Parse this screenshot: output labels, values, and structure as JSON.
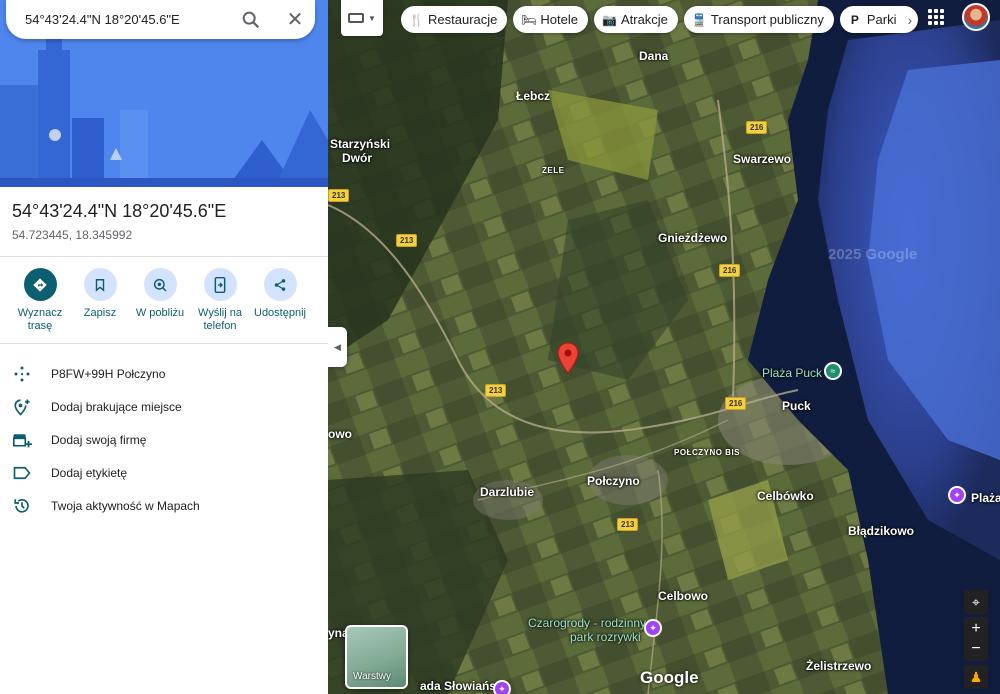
{
  "search": {
    "value": "54°43'24.4\"N 18°20'45.6\"E"
  },
  "place": {
    "title": "54°43'24.4\"N 18°20'45.6\"E",
    "decimal": "54.723445, 18.345992"
  },
  "actions": [
    {
      "label": "Wyznacz trasę",
      "icon": "directions-icon"
    },
    {
      "label": "Zapisz",
      "icon": "bookmark-icon"
    },
    {
      "label": "W pobliżu",
      "icon": "nearby-icon"
    },
    {
      "label": "Wyślij na telefon",
      "icon": "send-to-phone-icon"
    },
    {
      "label": "Udostępnij",
      "icon": "share-icon"
    }
  ],
  "list": [
    {
      "label": "P8FW+99H Połczyno",
      "icon": "plus-code-icon"
    },
    {
      "label": "Dodaj brakujące miejsce",
      "icon": "add-place-icon"
    },
    {
      "label": "Dodaj swoją firmę",
      "icon": "add-business-icon"
    },
    {
      "label": "Dodaj etykietę",
      "icon": "label-icon"
    },
    {
      "label": "Twoja aktywność w Mapach",
      "icon": "history-icon"
    }
  ],
  "chips": [
    {
      "label": "Restauracje",
      "icon": "restaurant-icon"
    },
    {
      "label": "Hotele",
      "icon": "hotel-icon"
    },
    {
      "label": "Atrakcje",
      "icon": "camera-icon"
    },
    {
      "label": "Transport publiczny",
      "icon": "transit-icon"
    },
    {
      "label": "Parki",
      "icon": "parking-icon"
    }
  ],
  "map": {
    "towns": [
      "Dana",
      "Łebcz",
      "Starzyński",
      "Dwór",
      "Swarzewo",
      "Gnieżdżewo",
      "ZELE",
      "Puck",
      "Plaża Puck",
      "POŁCZYNO BIS",
      "Darzlubie",
      "Połczyno",
      "Celbówko",
      "Błądzikowo",
      "Plaża",
      "Celbowo",
      "Czarogrody - rodzinny",
      "park rozrywki",
      "Żelistrzewo",
      "owo",
      "yna",
      "ada Słowiańska"
    ],
    "roads": [
      "216",
      "216",
      "216",
      "213",
      "213",
      "213",
      "213"
    ],
    "watermark": "2025 Google",
    "logo": "Google",
    "layers_label": "Warstwy"
  },
  "colors": {
    "accent": "#0b5f71",
    "hero": "#4f86ee",
    "pin": "#ea4335"
  }
}
